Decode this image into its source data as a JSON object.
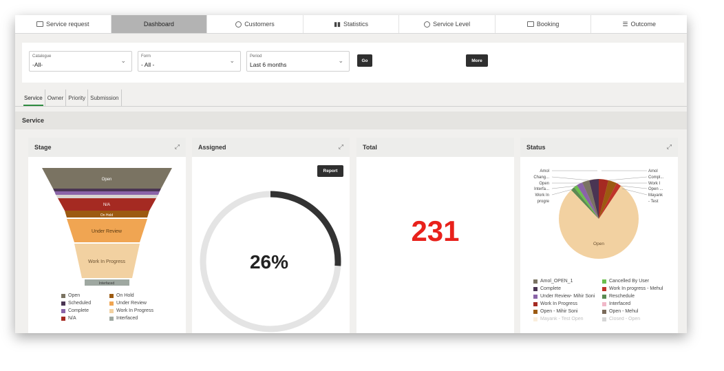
{
  "nav": {
    "tabs": [
      {
        "label": "Service request",
        "icon": "monitor-icon"
      },
      {
        "label": "Dashboard",
        "icon": ""
      },
      {
        "label": "Customers",
        "icon": "users-icon"
      },
      {
        "label": "Statistics",
        "icon": "bar-chart-icon"
      },
      {
        "label": "Service Level",
        "icon": "clock-icon"
      },
      {
        "label": "Booking",
        "icon": "envelope-icon"
      },
      {
        "label": "Outcome",
        "icon": "list-icon"
      }
    ],
    "active": "Dashboard"
  },
  "filters": {
    "catalogue": {
      "label": "Catalogue",
      "value": "-All-"
    },
    "form": {
      "label": "Form",
      "value": "- All -"
    },
    "period": {
      "label": "Period",
      "value": "Last 6 months"
    },
    "go_label": "Go",
    "more_label": "More"
  },
  "subtabs": {
    "items": [
      "Service",
      "Owner",
      "Priority",
      "Submission"
    ],
    "active": "Service"
  },
  "section": {
    "title": "Service"
  },
  "cards": {
    "stage": {
      "title": "Stage"
    },
    "assigned": {
      "title": "Assigned",
      "report_label": "Report",
      "percent_text": "26%",
      "percent_value": 26
    },
    "total": {
      "title": "Total",
      "value": "231"
    },
    "status": {
      "title": "Status"
    }
  },
  "funnel": {
    "segments": [
      {
        "label": "Open",
        "color": "#7a7362"
      },
      {
        "label": "",
        "color": "#4a3553"
      },
      {
        "label": "",
        "color": "#8a64a8"
      },
      {
        "label": "N/A",
        "color": "#a52a22"
      },
      {
        "label": "On Hold",
        "color": "#9c5a11"
      },
      {
        "label": "Under Review",
        "color": "#f0a552"
      },
      {
        "label": "Work In Progress",
        "color": "#f2d1a1"
      },
      {
        "label": "Interfaced",
        "color": "#9fa8a1"
      }
    ],
    "legend": [
      {
        "label": "Open",
        "color": "#7a7362"
      },
      {
        "label": "On Hold",
        "color": "#9c5a11"
      },
      {
        "label": "Scheduled",
        "color": "#4a3553"
      },
      {
        "label": "Under Review",
        "color": "#f0a552"
      },
      {
        "label": "Complete",
        "color": "#8a64a8"
      },
      {
        "label": "Work In Progress",
        "color": "#f2d1a1"
      },
      {
        "label": "N/A",
        "color": "#a52a22"
      },
      {
        "label": "Interfaced",
        "color": "#9fa8a1"
      }
    ]
  },
  "pie": {
    "center_label": "Open",
    "left_labels": [
      "Amol",
      "Chang...",
      "Open",
      "Interfa...",
      "Work In",
      "progre"
    ],
    "right_labels": [
      "Amol",
      "Compl...",
      "Work I",
      "Open ...",
      "Mayank",
      "- Test"
    ],
    "legend": [
      {
        "label": "Amol_OPEN_1",
        "color": "#7a7362"
      },
      {
        "label": "Cancelled By User",
        "color": "#6bbf4e"
      },
      {
        "label": "Complete",
        "color": "#4a3553"
      },
      {
        "label": "Work In progress - Mehul",
        "color": "#c0342a"
      },
      {
        "label": "Under Review- Mihir Soni",
        "color": "#8a64a8"
      },
      {
        "label": "Reschedule",
        "color": "#5a8a52"
      },
      {
        "label": "Work In Progress",
        "color": "#a52a22"
      },
      {
        "label": "Interfaced",
        "color": "#f0b8c8"
      },
      {
        "label": "Open - Mihir Soni",
        "color": "#9c5a11"
      },
      {
        "label": "Open - Mehul",
        "color": "#7a6a5a"
      },
      {
        "label": "Mayank - Test Open",
        "color": "#f2d1a1"
      },
      {
        "label": "Closed - Open",
        "color": "#8a8a8a"
      }
    ]
  }
}
